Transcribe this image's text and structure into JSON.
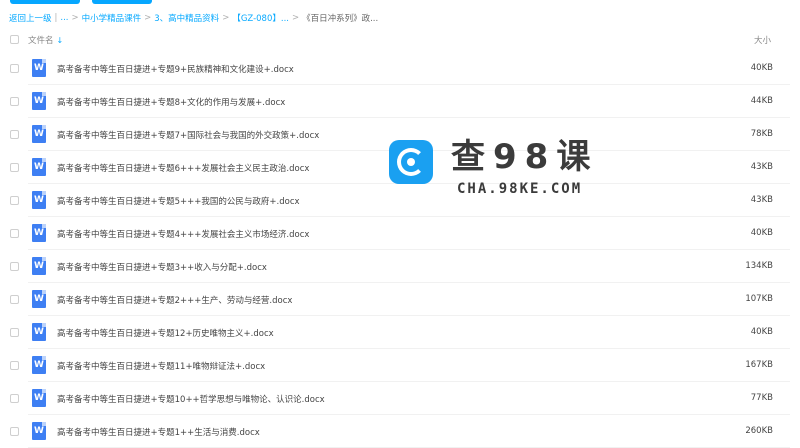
{
  "breadcrumb": {
    "back": "返回上一级",
    "sep1": "|",
    "ellipsis": "...",
    "items": [
      "中小学精品课件",
      "3、高中精品资料",
      "【GZ-080】...",
      "《百日冲系列》政..."
    ],
    "chevron": ">"
  },
  "header": {
    "name_label": "文件名",
    "sort_icon": "↓",
    "size_label": "大小"
  },
  "file_icon_letter": "W",
  "files": [
    {
      "name": "高考备考中等生百日捷进+专题9+民族精神和文化建设+.docx",
      "size": "40KB"
    },
    {
      "name": "高考备考中等生百日捷进+专题8+文化的作用与发展+.docx",
      "size": "44KB"
    },
    {
      "name": "高考备考中等生百日捷进+专题7+国际社会与我国的外交政策+.docx",
      "size": "78KB"
    },
    {
      "name": "高考备考中等生百日捷进+专题6+++发展社会主义民主政治.docx",
      "size": "43KB"
    },
    {
      "name": "高考备考中等生百日捷进+专题5+++我国的公民与政府+.docx",
      "size": "43KB"
    },
    {
      "name": "高考备考中等生百日捷进+专题4+++发展社会主义市场经济.docx",
      "size": "40KB"
    },
    {
      "name": "高考备考中等生百日捷进+专题3++收入与分配+.docx",
      "size": "134KB"
    },
    {
      "name": "高考备考中等生百日捷进+专题2+++生产、劳动与经营.docx",
      "size": "107KB"
    },
    {
      "name": "高考备考中等生百日捷进+专题12+历史唯物主义+.docx",
      "size": "40KB"
    },
    {
      "name": "高考备考中等生百日捷进+专题11+唯物辩证法+.docx",
      "size": "167KB"
    },
    {
      "name": "高考备考中等生百日捷进+专题10++哲学思想与唯物论、认识论.docx",
      "size": "77KB"
    },
    {
      "name": "高考备考中等生百日捷进+专题1++生活与消费.docx",
      "size": "260KB"
    }
  ],
  "watermark": {
    "title": "查98课",
    "subtitle": "CHA.98KE.COM"
  },
  "colors": {
    "accent": "#09aaff",
    "word_icon": "#3e7ff3",
    "logo_bg": "#1aa0f1"
  }
}
